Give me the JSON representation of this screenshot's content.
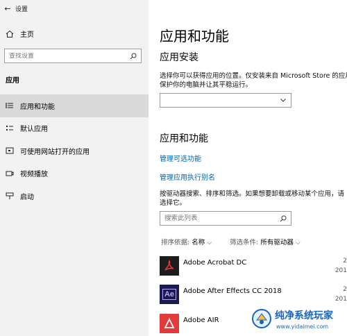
{
  "window": {
    "title": "设置"
  },
  "sidebar": {
    "home_label": "主页",
    "search_placeholder": "查找设置",
    "section_label": "应用",
    "items": [
      {
        "label": "应用和功能",
        "icon": "apps-features-icon",
        "active": true
      },
      {
        "label": "默认应用",
        "icon": "default-apps-icon",
        "active": false
      },
      {
        "label": "可使用网站打开的应用",
        "icon": "apps-for-websites-icon",
        "active": false
      },
      {
        "label": "视频播放",
        "icon": "video-playback-icon",
        "active": false
      },
      {
        "label": "启动",
        "icon": "startup-icon",
        "active": false
      }
    ]
  },
  "main": {
    "title": "应用和功能",
    "install": {
      "heading": "应用安装",
      "desc_line1": "选择你可以获得应用的位置。仅安装来自 Microsoft Store 的应用",
      "desc_line2": "保护你的电脑并让其平稳运行。",
      "dropdown_value": ""
    },
    "features": {
      "heading": "应用和功能",
      "link_optional": "管理可选功能",
      "link_alias": "管理应用执行别名",
      "desc_line1": "按驱动器搜索、排序和筛选。如果想要卸载或移动某个应用，请",
      "desc_line2": "选择它。",
      "search_placeholder": "搜索此列表",
      "sort_label": "排序依据:",
      "sort_value": "名称",
      "filter_label": "筛选条件:",
      "filter_value": "所有驱动器"
    },
    "apps": [
      {
        "name": "Adobe Acrobat DC",
        "meta1": "2",
        "meta2": "201"
      },
      {
        "name": "Adobe After Effects CC 2018",
        "meta1": "2",
        "meta2": "201"
      },
      {
        "name": "Adobe AIR",
        "meta1": "",
        "meta2": ""
      }
    ]
  },
  "watermark": {
    "title": "纯净系统玩家",
    "url": "www.yidaimei.com"
  },
  "colors": {
    "link": "#0063b1",
    "sidebar_bg": "#f2f2f2",
    "active_bg": "#d9d9d9"
  }
}
